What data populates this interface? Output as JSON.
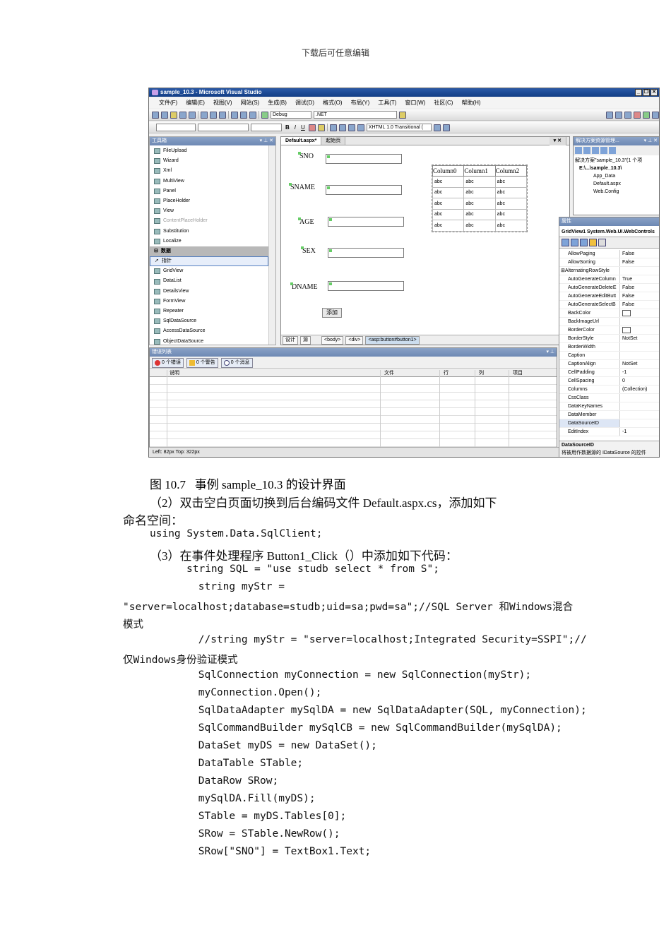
{
  "header": "下载后可任意编辑",
  "vs": {
    "title": "sample_10.3 - Microsoft Visual Studio",
    "window_buttons": [
      "_",
      "❐",
      "✕"
    ],
    "menu": [
      "文件(F)",
      "编辑(E)",
      "视图(V)",
      "网站(S)",
      "生成(B)",
      "调试(D)",
      "格式(O)",
      "布局(Y)",
      "工具(T)",
      "窗口(W)",
      "社区(C)",
      "帮助(H)"
    ],
    "toolbar": {
      "config": "Debug",
      "platform": ".NET",
      "doctype": "XHTML 1.0 Transitional ("
    },
    "toolbox": {
      "title": "工具箱",
      "items": [
        "FileUpload",
        "Wizard",
        "Xml",
        "MultiView",
        "Panel",
        "PlaceHolder",
        "View",
        "ContentPlaceHolder",
        "Substitution",
        "Localize"
      ],
      "category": "数据",
      "data_items": [
        "指针",
        "GridView",
        "DataList",
        "DetailsView",
        "FormView",
        "Repeater",
        "SqlDataSource",
        "AccessDataSource",
        "ObjectDataSource"
      ]
    },
    "designer": {
      "tabs": [
        "Default.aspx*",
        "起始页"
      ],
      "labels": [
        "SNO",
        "SNAME",
        "AGE",
        "SEX",
        "DNAME"
      ],
      "button": "添加",
      "grid_columns": [
        "Column0",
        "Column1",
        "Column2"
      ],
      "grid_cell": "abc",
      "grid_rows": 5,
      "bottom_tabs": [
        "设计",
        "源"
      ],
      "breadcrumb": [
        "<body>",
        "<div>",
        "<asp:button#button1>"
      ]
    },
    "solution": {
      "title": "解决方案资源管理...",
      "tree": [
        "解决方案\"sample_10.3\"(1 个项",
        "E:\\...\\sample_10.3\\",
        "App_Data",
        "Default.aspx",
        "Web.Config"
      ]
    },
    "properties": {
      "title": "属性",
      "object": "GridView1 System.Web.UI.WebControls",
      "rows": [
        [
          "AllowPaging",
          "False"
        ],
        [
          "AllowSorting",
          "False"
        ],
        [
          "AlternatingRowStyle",
          ""
        ],
        [
          "AutoGenerateColumn",
          "True"
        ],
        [
          "AutoGenerateDeleteE",
          "False"
        ],
        [
          "AutoGenerateEditButt",
          "False"
        ],
        [
          "AutoGenerateSelectB",
          "False"
        ],
        [
          "BackColor",
          ""
        ],
        [
          "BackImageUrl",
          ""
        ],
        [
          "BorderColor",
          ""
        ],
        [
          "BorderStyle",
          "NotSet"
        ],
        [
          "BorderWidth",
          ""
        ],
        [
          "Caption",
          ""
        ],
        [
          "CaptionAlign",
          "NotSet"
        ],
        [
          "CellPadding",
          "-1"
        ],
        [
          "CellSpacing",
          "0"
        ],
        [
          "Columns",
          "(Collection)"
        ],
        [
          "CssClass",
          ""
        ],
        [
          "DataKeyNames",
          ""
        ],
        [
          "DataMember",
          ""
        ],
        [
          "DataSourceID",
          ""
        ],
        [
          "EditIndex",
          "-1"
        ]
      ],
      "desc_title": "DataSourceID",
      "desc_text": "将被用作数据源的 IDataSource 的控件"
    },
    "errors": {
      "title": "错误列表",
      "filters": [
        "0 个错误",
        "0 个警告",
        "0 个消息"
      ],
      "columns": [
        "说明",
        "文件",
        "行",
        "列",
        "项目"
      ]
    },
    "status": "Left: 82px  Top: 322px"
  },
  "doc": {
    "caption": "图 10.7   事例 sample_10.3 的设计界面",
    "lines": [
      "（2）双击空白页面切换到后台编码文件 Default.aspx.cs，添加如下",
      "命名空间：",
      "using System.Data.SqlClient;",
      "（3）在事件处理程序 Button1_Click（）中添加如下代码：",
      "string SQL = \"use studb select * from S\";",
      " string myStr =",
      "\"server=localhost;database=studb;uid=sa;pwd=sa\";//SQL Server 和Windows混合",
      "模式",
      " //string myStr = \"server=localhost;Integrated Security=SSPI\";//",
      "仅Windows身份验证模式",
      " SqlConnection myConnection = new SqlConnection(myStr);",
      " myConnection.Open();",
      " SqlDataAdapter mySqlDA = new SqlDataAdapter(SQL, myConnection);",
      " SqlCommandBuilder mySqlCB = new SqlCommandBuilder(mySqlDA);",
      " DataSet myDS = new DataSet();",
      " DataTable STable;",
      " DataRow SRow;",
      " mySqlDA.Fill(myDS);",
      " STable = myDS.Tables[0];",
      " SRow = STable.NewRow();",
      " SRow[\"SNO\"] = TextBox1.Text;"
    ]
  }
}
